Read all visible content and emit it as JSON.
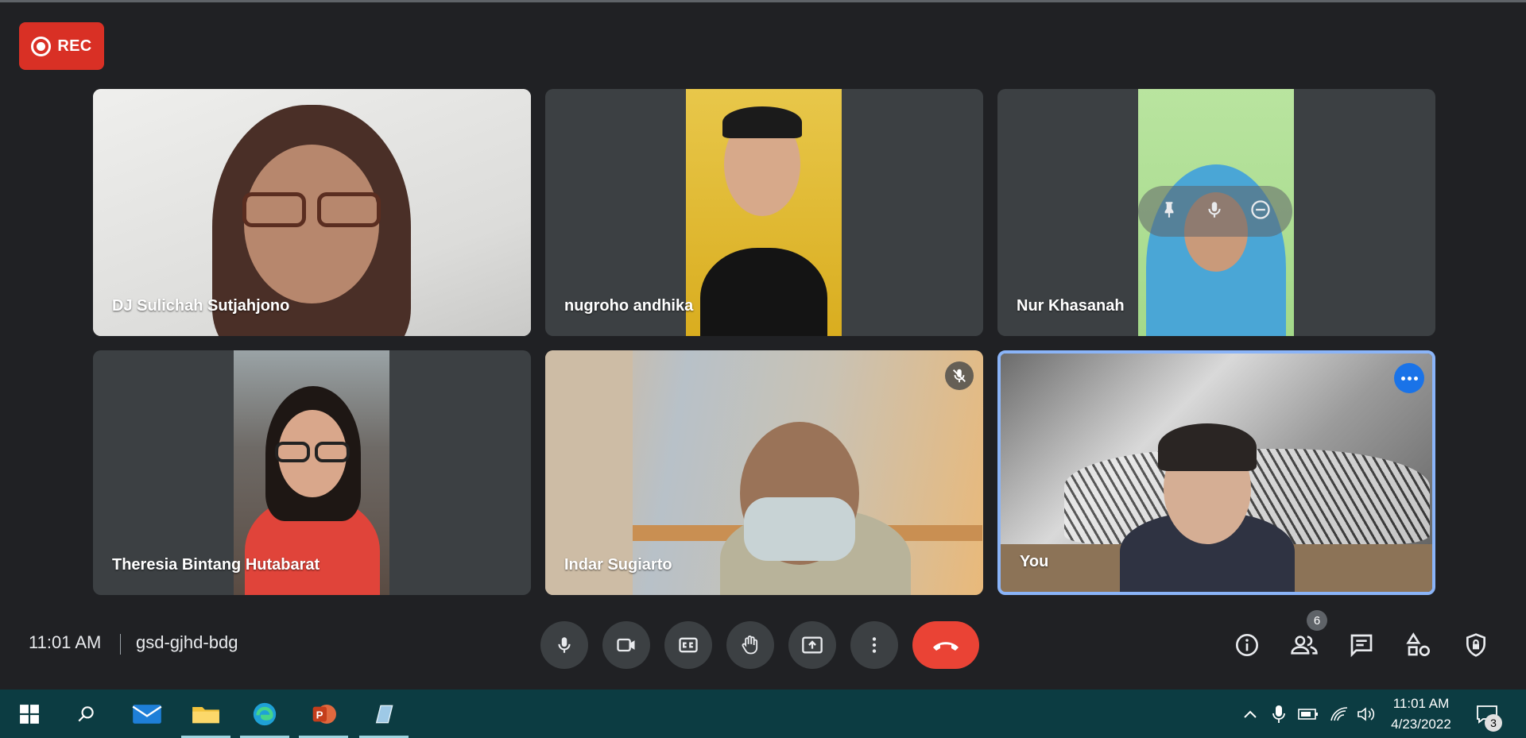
{
  "recording": {
    "label": "REC"
  },
  "participants": [
    {
      "name": "DJ Sulichah Sutjahjono"
    },
    {
      "name": "nugroho andhika"
    },
    {
      "name": "Nur Khasanah"
    },
    {
      "name": "Theresia Bintang Hutabarat"
    },
    {
      "name": "Indar Sugiarto"
    },
    {
      "name": "You"
    }
  ],
  "meeting": {
    "time": "11:01 AM",
    "code": "gsd-gjhd-bdg"
  },
  "controls": [
    "microphone-icon",
    "camera-icon",
    "captions-icon",
    "raise-hand-icon",
    "present-icon",
    "more-options-icon",
    "end-call-icon"
  ],
  "right_controls": {
    "people_count": "6"
  },
  "taskbar": {
    "time": "11:01 AM",
    "date": "4/23/2022",
    "notifications": "3"
  },
  "colors": {
    "background": "#202124",
    "tile": "#3c4043",
    "record": "#d93025",
    "end_call": "#ea4335",
    "self_border": "#8ab4f8",
    "taskbar": "#0c3c42"
  }
}
